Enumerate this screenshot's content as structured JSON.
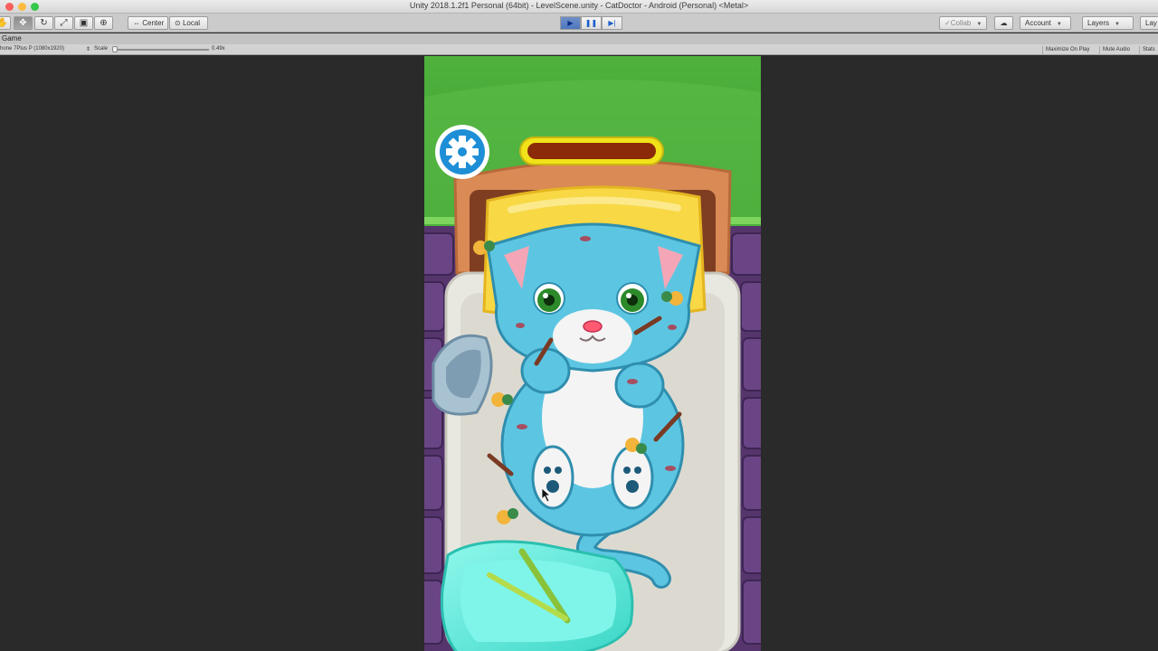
{
  "window": {
    "title": "Unity 2018.1.2f1 Personal (64bit) - LevelScene.unity - CatDoctor - Android (Personal) <Metal>"
  },
  "toolbar": {
    "pivot_label": "Center",
    "space_label": "Local",
    "collab_label": "Collab",
    "account_label": "Account",
    "layers_label": "Layers",
    "layout_label": "Lay"
  },
  "game_tab": {
    "label": "Game"
  },
  "game_bar": {
    "resolution": "hone 7Plus P (1080x1920)",
    "scale_label": "Scale",
    "scale_value": "0.49x",
    "maximize_label": "Maximize On Play",
    "mute_label": "Mute Audio",
    "stats_label": "Stats"
  },
  "colors": {
    "grass": "#4daf3c",
    "wall": "#5c3a72",
    "cat_body": "#5cc6e2",
    "health_bar": "#8a2a08",
    "health_border": "#f2e21a",
    "tray": "#6ef0e2",
    "pillow": "#f8d844"
  }
}
